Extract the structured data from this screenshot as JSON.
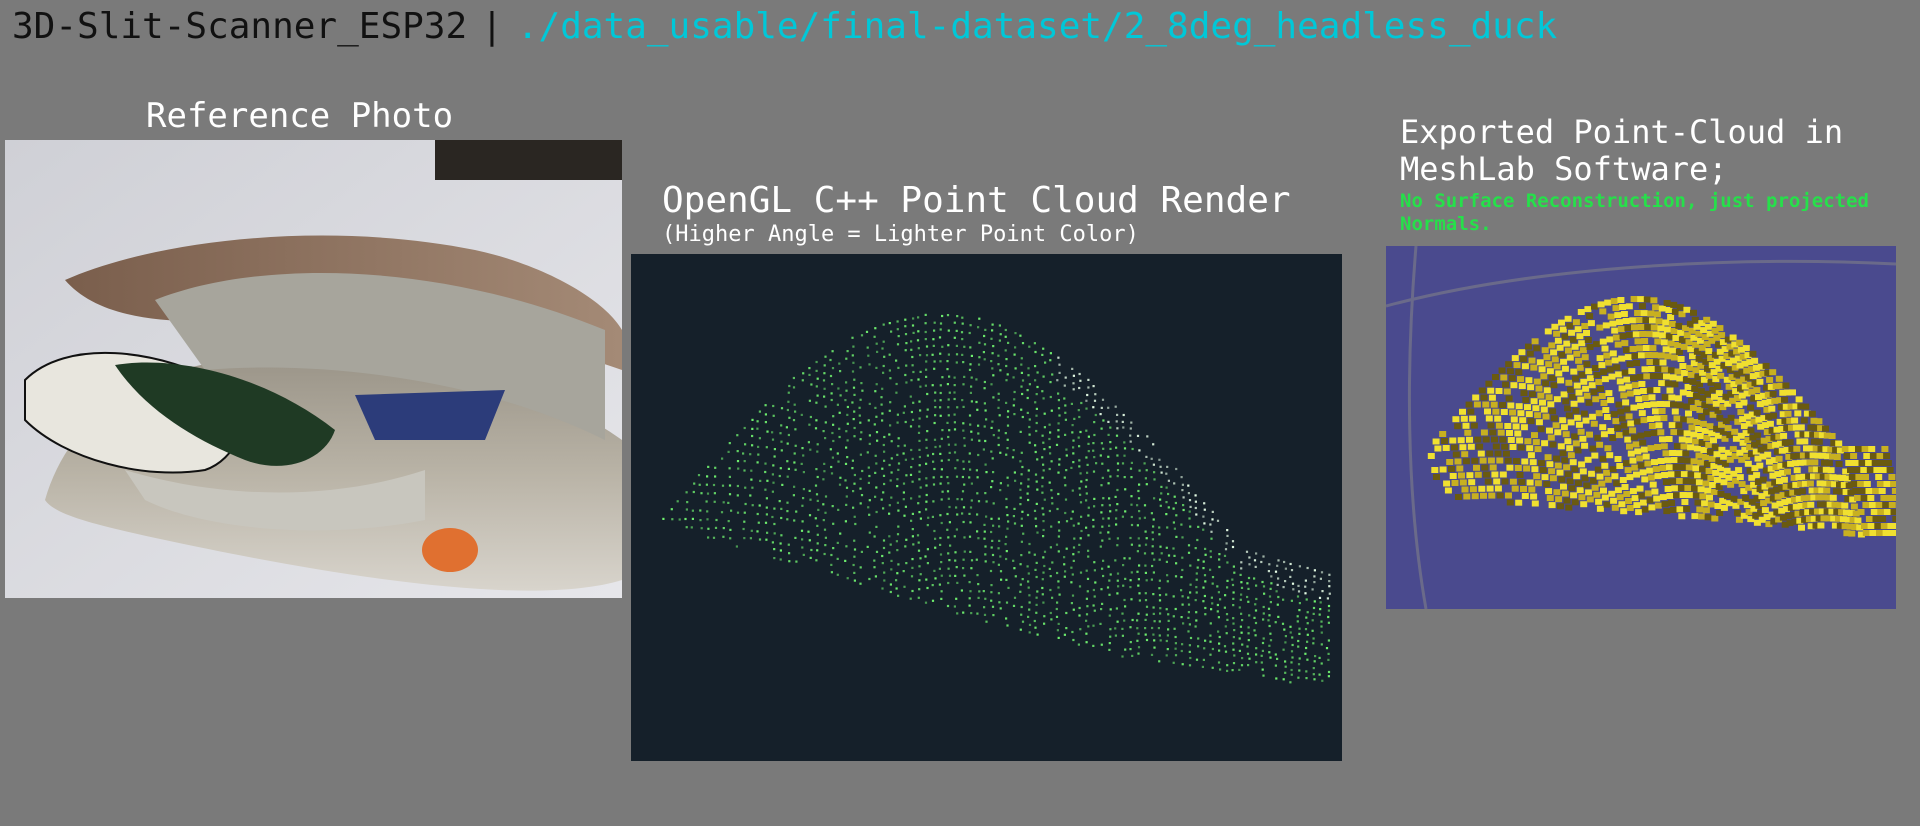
{
  "header": {
    "app_name": "3D-Slit-Scanner_ESP32",
    "separator": "|",
    "dataset_path": "./data_usable/final-dataset/2_8deg_headless_duck"
  },
  "reference": {
    "title": "Reference Photo"
  },
  "opengl": {
    "title": "OpenGL C++ Point Cloud Render",
    "subtitle": "(Higher Angle = Lighter Point Color)"
  },
  "meshlab": {
    "title": "Exported Point-Cloud in MeshLab Software;",
    "note": "No Surface Reconstruction, just projected Normals."
  },
  "colors": {
    "background": "#7a7a7a",
    "path_accent": "#00c8d8",
    "note_green": "#26e04a",
    "gl_background": "#15202a",
    "point_green": "#6ff06f",
    "meshlab_background": "#4a4a8e",
    "meshlab_points": "#f0e030"
  }
}
